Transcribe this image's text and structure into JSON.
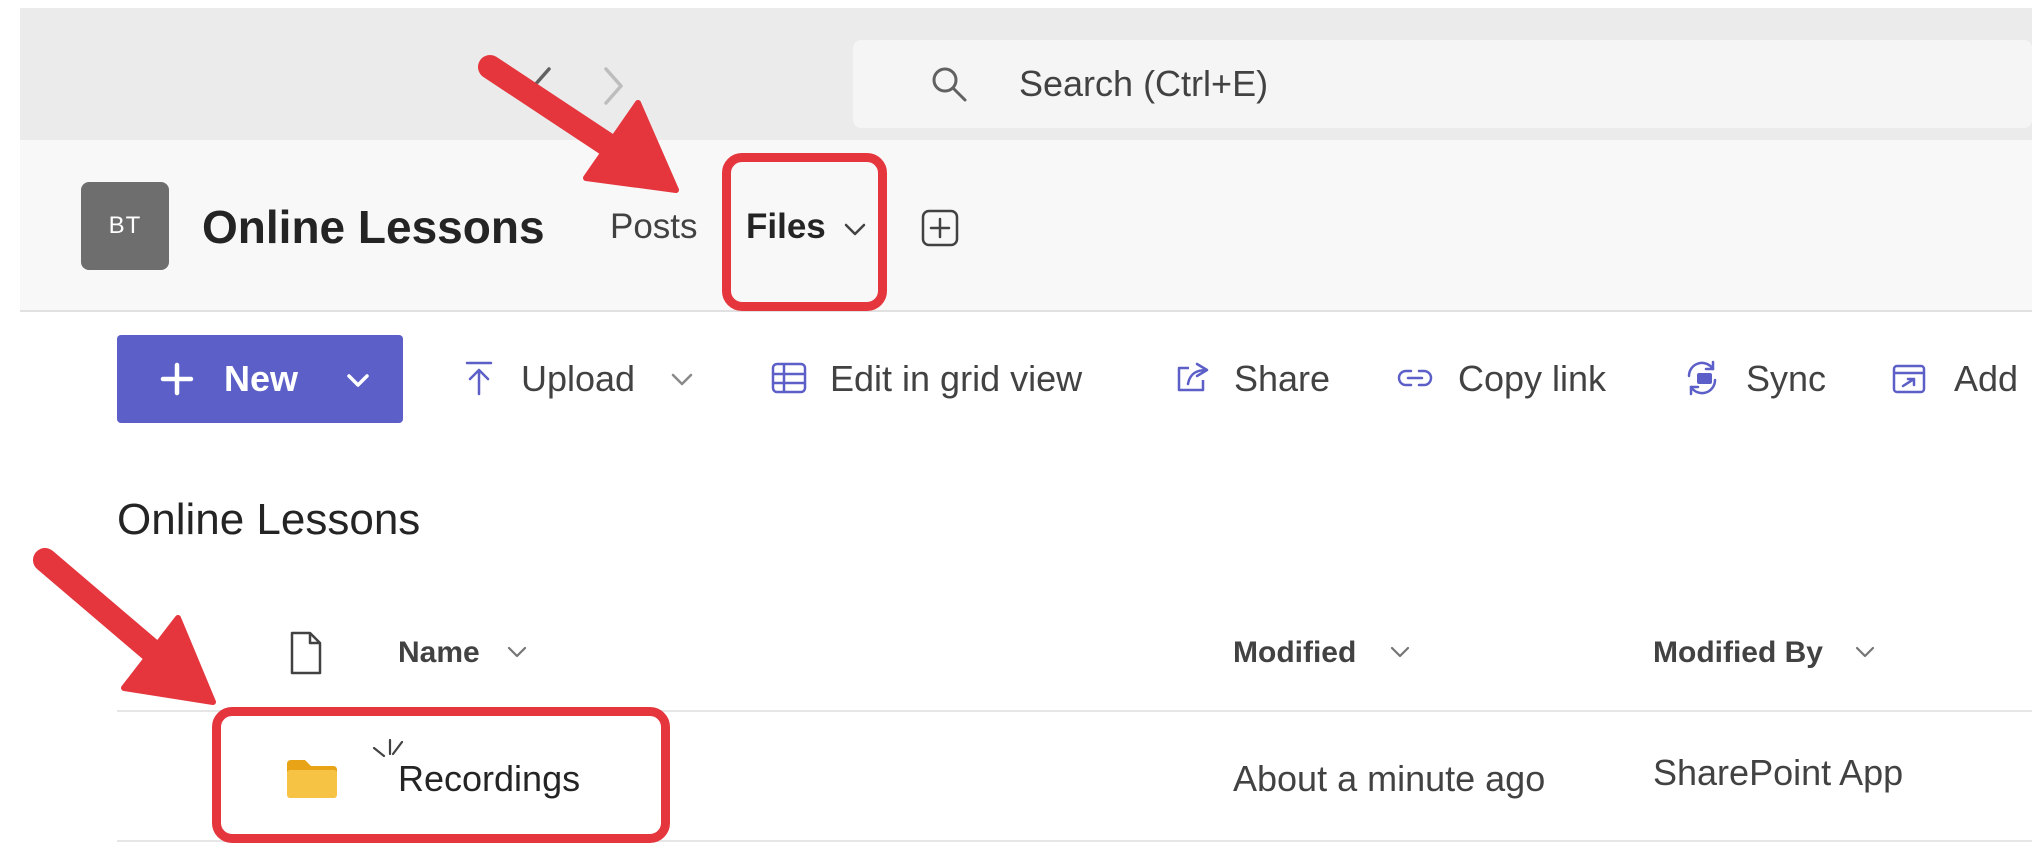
{
  "nav": {
    "back_icon": "chevron-left-icon",
    "forward_icon": "chevron-right-icon"
  },
  "search": {
    "icon": "search-icon",
    "placeholder": "Search (Ctrl+E)"
  },
  "channel": {
    "avatar_initials": "BT",
    "team_name": "Online Lessons",
    "tabs": [
      {
        "label": "Posts",
        "selected": false
      },
      {
        "label": "Files",
        "selected": true
      }
    ],
    "add_tab_icon": "add-tab-icon"
  },
  "toolbar": {
    "new_label": "New",
    "upload_label": "Upload",
    "edit_grid_label": "Edit in grid view",
    "share_label": "Share",
    "copy_link_label": "Copy link",
    "sync_label": "Sync",
    "add_label": "Add"
  },
  "library": {
    "heading": "Online Lessons",
    "columns": {
      "name": "Name",
      "modified": "Modified",
      "modified_by": "Modified By"
    },
    "rows": [
      {
        "type": "folder",
        "name": "Recordings",
        "modified": "About a minute ago",
        "modified_by": "SharePoint App"
      }
    ]
  },
  "colors": {
    "accent": "#5b5fc7",
    "annotation": "#e5353d",
    "folder": "#f6c345"
  }
}
